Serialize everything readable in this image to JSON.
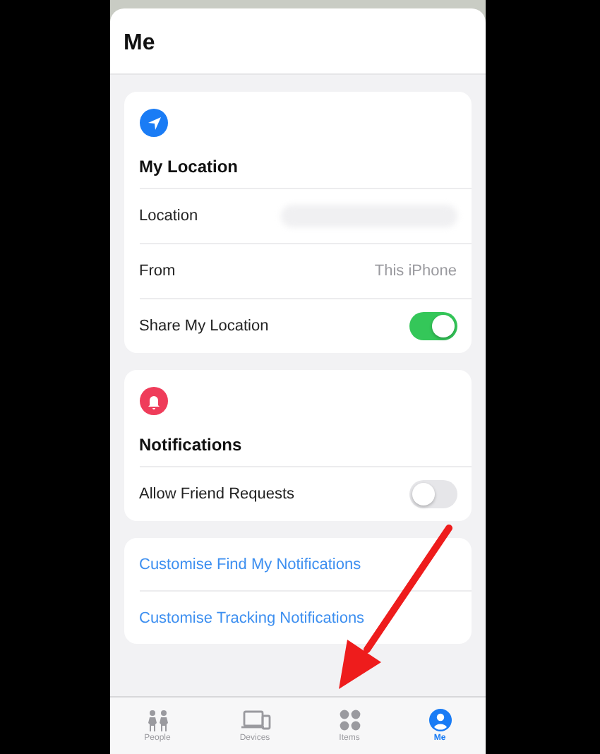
{
  "sheet": {
    "title": "Me"
  },
  "sections": [
    {
      "color": "#1a7cf5",
      "title": "My Location",
      "rows": [
        {
          "kind": "value",
          "label": "Location",
          "blurred": true
        },
        {
          "kind": "value",
          "label": "From",
          "value": "This iPhone",
          "blurred": false
        },
        {
          "kind": "toggle",
          "label": "Share My Location",
          "on": true
        }
      ]
    },
    {
      "color": "#ef3c5a",
      "title": "Notifications",
      "rows": [
        {
          "kind": "toggle",
          "label": "Allow Friend Requests",
          "on": false
        }
      ]
    }
  ],
  "links": [
    "Customise Find My Notifications",
    "Customise Tracking Notifications"
  ],
  "tabs": [
    {
      "label": "People",
      "selected": false
    },
    {
      "label": "Devices",
      "selected": false
    },
    {
      "label": "Items",
      "selected": false
    },
    {
      "label": "Me",
      "selected": true
    }
  ],
  "annotation": {
    "kind": "arrow"
  }
}
